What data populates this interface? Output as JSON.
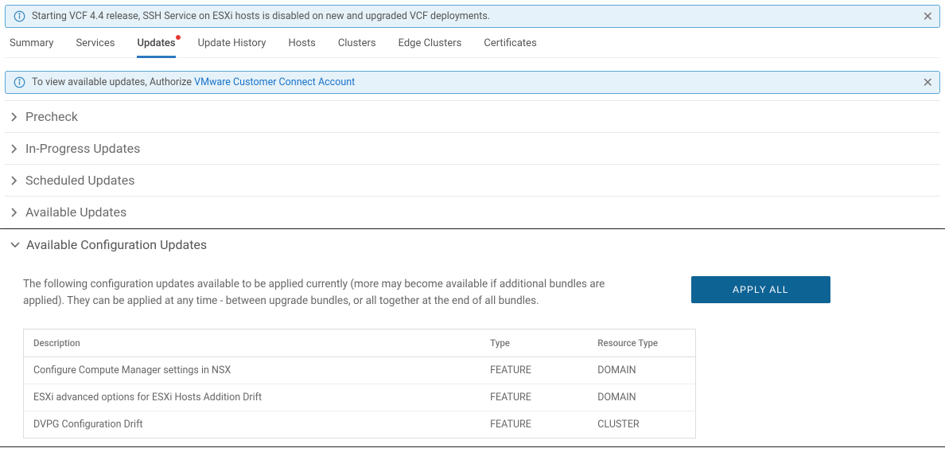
{
  "top_banner": {
    "text": "Starting VCF 4.4 release, SSH Service on ESXi hosts is disabled on new and upgraded VCF deployments."
  },
  "tabs": [
    {
      "label": "Summary",
      "active": false,
      "has_dot": false
    },
    {
      "label": "Services",
      "active": false,
      "has_dot": false
    },
    {
      "label": "Updates",
      "active": true,
      "has_dot": true
    },
    {
      "label": "Update History",
      "active": false,
      "has_dot": false
    },
    {
      "label": "Hosts",
      "active": false,
      "has_dot": false
    },
    {
      "label": "Clusters",
      "active": false,
      "has_dot": false
    },
    {
      "label": "Edge Clusters",
      "active": false,
      "has_dot": false
    },
    {
      "label": "Certificates",
      "active": false,
      "has_dot": false
    }
  ],
  "auth_banner": {
    "prefix": "To view available updates, Authorize ",
    "link": "VMware Customer Connect Account"
  },
  "sections": {
    "precheck": "Precheck",
    "inprogress": "In-Progress Updates",
    "scheduled": "Scheduled Updates",
    "available": "Available Updates",
    "config": "Available Configuration Updates"
  },
  "config_body": {
    "description": "The following configuration updates available to be applied currently (more may become available if additional bundles are applied). They can be applied at any time - between upgrade bundles, or all together at the end of all bundles.",
    "apply_all": "APPLY ALL",
    "columns": {
      "desc": "Description",
      "type": "Type",
      "res": "Resource Type"
    },
    "rows": [
      {
        "desc": "Configure Compute Manager settings in NSX",
        "type": "FEATURE",
        "res": "DOMAIN"
      },
      {
        "desc": "ESXi advanced options for ESXi Hosts Addition Drift",
        "type": "FEATURE",
        "res": "DOMAIN"
      },
      {
        "desc": "DVPG Configuration Drift",
        "type": "FEATURE",
        "res": "CLUSTER"
      }
    ]
  }
}
